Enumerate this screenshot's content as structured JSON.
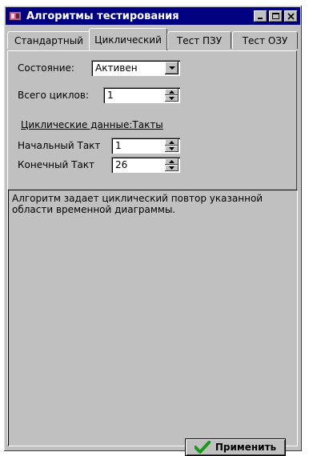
{
  "window": {
    "title": "Алгоритмы тестирования"
  },
  "tabs": [
    "Стандартный",
    "Циклический",
    "Тест ПЗУ",
    "Тест ОЗУ"
  ],
  "active_tab": "Циклический",
  "form": {
    "state_label": "Состояние:",
    "state_value": "Активен",
    "cycles_label": "Всего циклов:",
    "cycles_value": "1",
    "section_title": "Циклические данные:Такты",
    "start_label": "Начальный Такт",
    "start_value": "1",
    "end_label": "Конечный Такт",
    "end_value": "26"
  },
  "description": "Алгоритм задает циклический повтор указанной области временной диаграммы.",
  "apply_button": "Применить",
  "icons": {
    "app": "app-icon",
    "minimize": "minimize-icon",
    "maximize": "maximize-icon",
    "close": "close-icon",
    "apply": "checkmark-icon"
  }
}
